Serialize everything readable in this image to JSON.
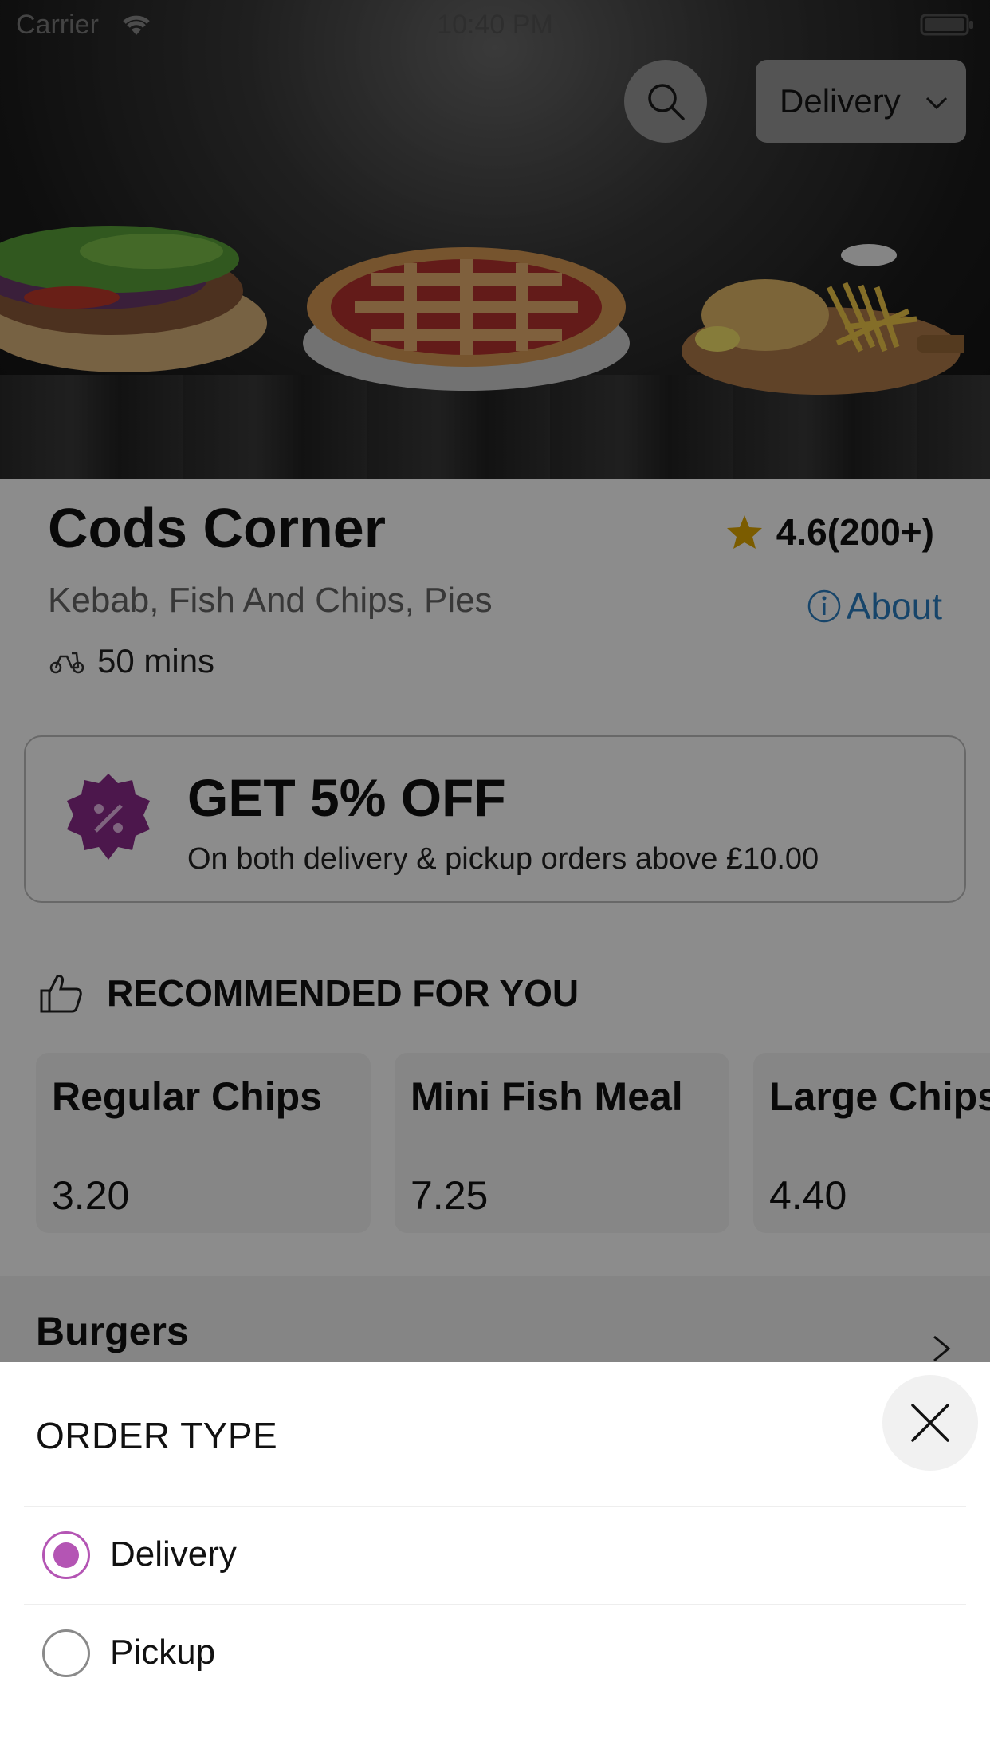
{
  "status_bar": {
    "carrier": "Carrier",
    "time": "10:40 PM"
  },
  "header": {
    "order_type_selected": "Delivery"
  },
  "restaurant": {
    "name": "Cods Corner",
    "rating": "4.6(200+)",
    "cuisines": "Kebab, Fish And Chips, Pies",
    "about_label": "About",
    "delivery_time": "50 mins"
  },
  "offer": {
    "title": "GET 5% OFF",
    "subtitle": "On both delivery & pickup orders above £10.00"
  },
  "recommended": {
    "heading": "RECOMMENDED FOR YOU",
    "items": [
      {
        "name": "Regular Chips",
        "price": "3.20"
      },
      {
        "name": "Mini Fish Meal",
        "price": "7.25"
      },
      {
        "name": "Large Chips",
        "price": "4.40"
      }
    ]
  },
  "category": {
    "title": "Burgers"
  },
  "order_sheet": {
    "title": "ORDER TYPE",
    "options": [
      {
        "label": "Delivery",
        "selected": true
      },
      {
        "label": "Pickup",
        "selected": false
      }
    ]
  },
  "colors": {
    "accent": "#b455b4",
    "link": "#2b7fc1",
    "star": "#e0a800",
    "offer_badge": "#8a2a8a"
  },
  "icons": [
    "wifi-icon",
    "battery-icon",
    "search-icon",
    "chevron-down-icon",
    "star-icon",
    "info-icon",
    "scooter-icon",
    "discount-badge-icon",
    "thumbs-up-icon",
    "chevron-right-icon",
    "close-icon"
  ]
}
